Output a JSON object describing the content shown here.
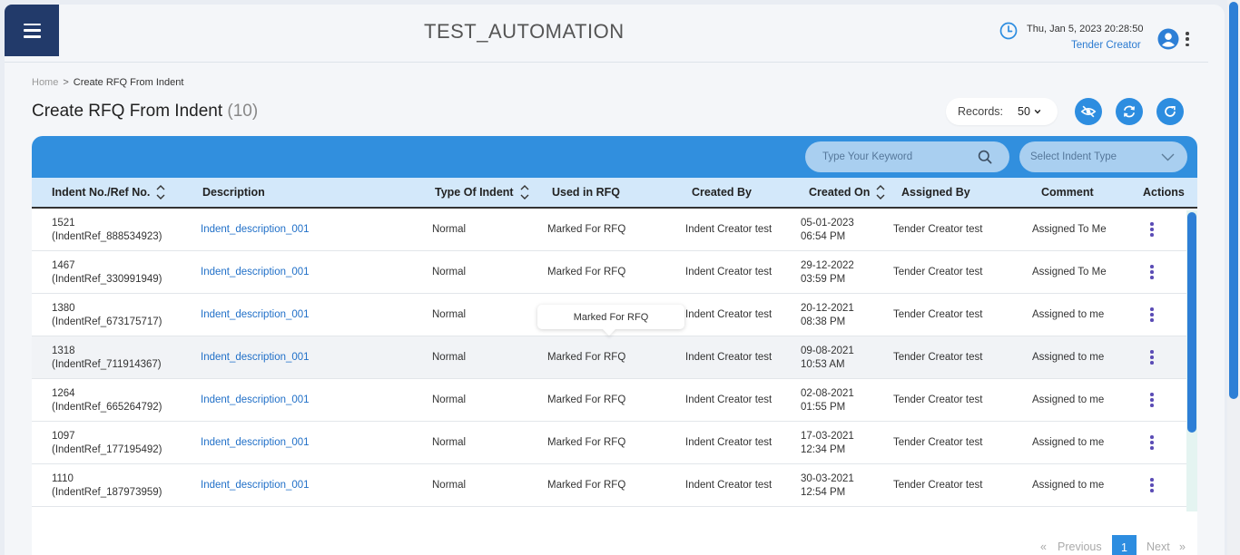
{
  "header": {
    "app_title": "TEST_AUTOMATION",
    "datetime": "Thu, Jan 5, 2023 20:28:50",
    "role": "Tender Creator"
  },
  "breadcrumb": {
    "home": "Home",
    "separator": ">",
    "current": "Create RFQ From Indent"
  },
  "page": {
    "title": "Create RFQ From Indent",
    "count": "(10)"
  },
  "toolbar": {
    "records_label": "Records:",
    "records_value": "50"
  },
  "filters": {
    "search_placeholder": "Type Your Keyword",
    "indent_type_placeholder": "Select Indent Type"
  },
  "table": {
    "columns": [
      "Indent No./Ref No.",
      "Description",
      "Type Of Indent",
      "Used in RFQ",
      "Created By",
      "Created On",
      "Assigned By",
      "Comment",
      "Actions"
    ],
    "rows": [
      {
        "no": "1521",
        "ref": "(IndentRef_888534923)",
        "desc": "Indent_description_001",
        "type": "Normal",
        "used": "Marked For RFQ",
        "created_by": "Indent Creator test",
        "date": "05-01-2023",
        "time": "06:54 PM",
        "assigned_by": "Tender Creator test",
        "comment": "Assigned To Me"
      },
      {
        "no": "1467",
        "ref": "(IndentRef_330991949)",
        "desc": "Indent_description_001",
        "type": "Normal",
        "used": "Marked For RFQ",
        "created_by": "Indent Creator test",
        "date": "29-12-2022",
        "time": "03:59 PM",
        "assigned_by": "Tender Creator test",
        "comment": "Assigned To Me"
      },
      {
        "no": "1380",
        "ref": "(IndentRef_673175717)",
        "desc": "Indent_description_001",
        "type": "Normal",
        "used": "",
        "created_by": "Indent Creator test",
        "date": "20-12-2021",
        "time": "08:38 PM",
        "assigned_by": "Tender Creator test",
        "comment": "Assigned to me"
      },
      {
        "no": "1318",
        "ref": "(IndentRef_711914367)",
        "desc": "Indent_description_001",
        "type": "Normal",
        "used": "Marked For RFQ",
        "created_by": "Indent Creator test",
        "date": "09-08-2021",
        "time": "10:53 AM",
        "assigned_by": "Tender Creator test",
        "comment": "Assigned to me"
      },
      {
        "no": "1264",
        "ref": "(IndentRef_665264792)",
        "desc": "Indent_description_001",
        "type": "Normal",
        "used": "Marked For RFQ",
        "created_by": "Indent Creator test",
        "date": "02-08-2021",
        "time": "01:55 PM",
        "assigned_by": "Tender Creator test",
        "comment": "Assigned to me"
      },
      {
        "no": "1097",
        "ref": "(IndentRef_177195492)",
        "desc": "Indent_description_001",
        "type": "Normal",
        "used": "Marked For RFQ",
        "created_by": "Indent Creator test",
        "date": "17-03-2021",
        "time": "12:34 PM",
        "assigned_by": "Tender Creator test",
        "comment": "Assigned to me"
      },
      {
        "no": "1110",
        "ref": "(IndentRef_187973959)",
        "desc": "Indent_description_001",
        "type": "Normal",
        "used": "Marked For RFQ",
        "created_by": "Indent Creator test",
        "date": "30-03-2021",
        "time": "12:54 PM",
        "assigned_by": "Tender Creator test",
        "comment": "Assigned to me"
      }
    ]
  },
  "tooltip": {
    "text": "Marked For RFQ"
  },
  "pagination": {
    "prev_arrow": "«",
    "previous": "Previous",
    "current": "1",
    "next": "Next",
    "next_arrow": "»"
  },
  "icons": {
    "menu": "hamburger-icon",
    "clock": "clock-icon",
    "avatar": "user-avatar-icon",
    "more": "kebab-icon",
    "hide": "eye-slash-icon",
    "sync": "sync-icon",
    "refresh": "refresh-icon",
    "search": "search-icon",
    "dropdown": "chevron-down-icon",
    "sort": "sort-icon"
  },
  "colors": {
    "primary": "#318fde",
    "nav": "#223a6a",
    "link": "#2170c8",
    "header_row": "#d3e8fa",
    "action_dots": "#5a4bb5"
  }
}
